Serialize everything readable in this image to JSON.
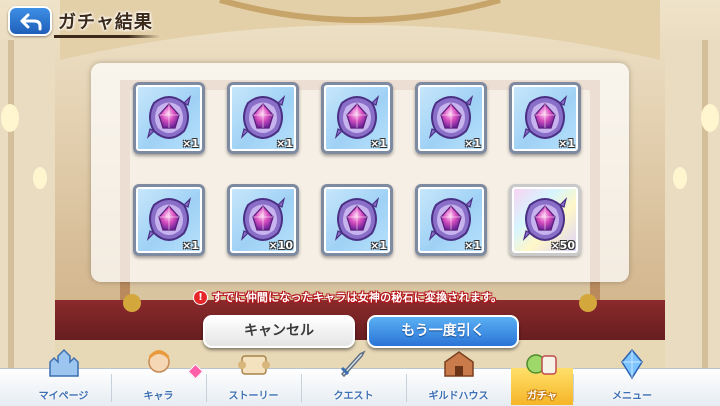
{
  "header": {
    "title": "ガチャ結果",
    "back_icon": "back-arrow-icon"
  },
  "results": [
    {
      "item": "goddess-stone-icon",
      "qty": "×1",
      "rarity": "normal"
    },
    {
      "item": "goddess-stone-icon",
      "qty": "×1",
      "rarity": "normal"
    },
    {
      "item": "goddess-stone-icon",
      "qty": "×1",
      "rarity": "normal"
    },
    {
      "item": "goddess-stone-icon",
      "qty": "×1",
      "rarity": "normal"
    },
    {
      "item": "goddess-stone-icon",
      "qty": "×1",
      "rarity": "normal"
    },
    {
      "item": "goddess-stone-icon",
      "qty": "×1",
      "rarity": "normal"
    },
    {
      "item": "goddess-stone-icon",
      "qty": "×10",
      "rarity": "normal"
    },
    {
      "item": "goddess-stone-icon",
      "qty": "×1",
      "rarity": "normal"
    },
    {
      "item": "goddess-stone-icon",
      "qty": "×1",
      "rarity": "normal"
    },
    {
      "item": "goddess-stone-icon",
      "qty": "×50",
      "rarity": "rainbow"
    }
  ],
  "notice": "すでに仲間になったキャラは女神の秘石に変換されます。",
  "buttons": {
    "cancel": "キャンセル",
    "again": "もう一度引く"
  },
  "nav": [
    {
      "label": "マイページ",
      "icon": "castle-icon"
    },
    {
      "label": "キャラ",
      "icon": "character-icon"
    },
    {
      "label": "ストーリー",
      "icon": "scroll-icon"
    },
    {
      "label": "クエスト",
      "icon": "sword-icon"
    },
    {
      "label": "ギルドハウス",
      "icon": "guild-house-icon"
    },
    {
      "label": "ガチャ",
      "icon": "gacha-icon"
    },
    {
      "label": "メニュー",
      "icon": "crystal-icon"
    }
  ],
  "active_nav": "ガチャ",
  "colors": {
    "accent_blue": "#2a74d6",
    "notice_red": "#b3151a",
    "active_tab": "#f5b528"
  }
}
